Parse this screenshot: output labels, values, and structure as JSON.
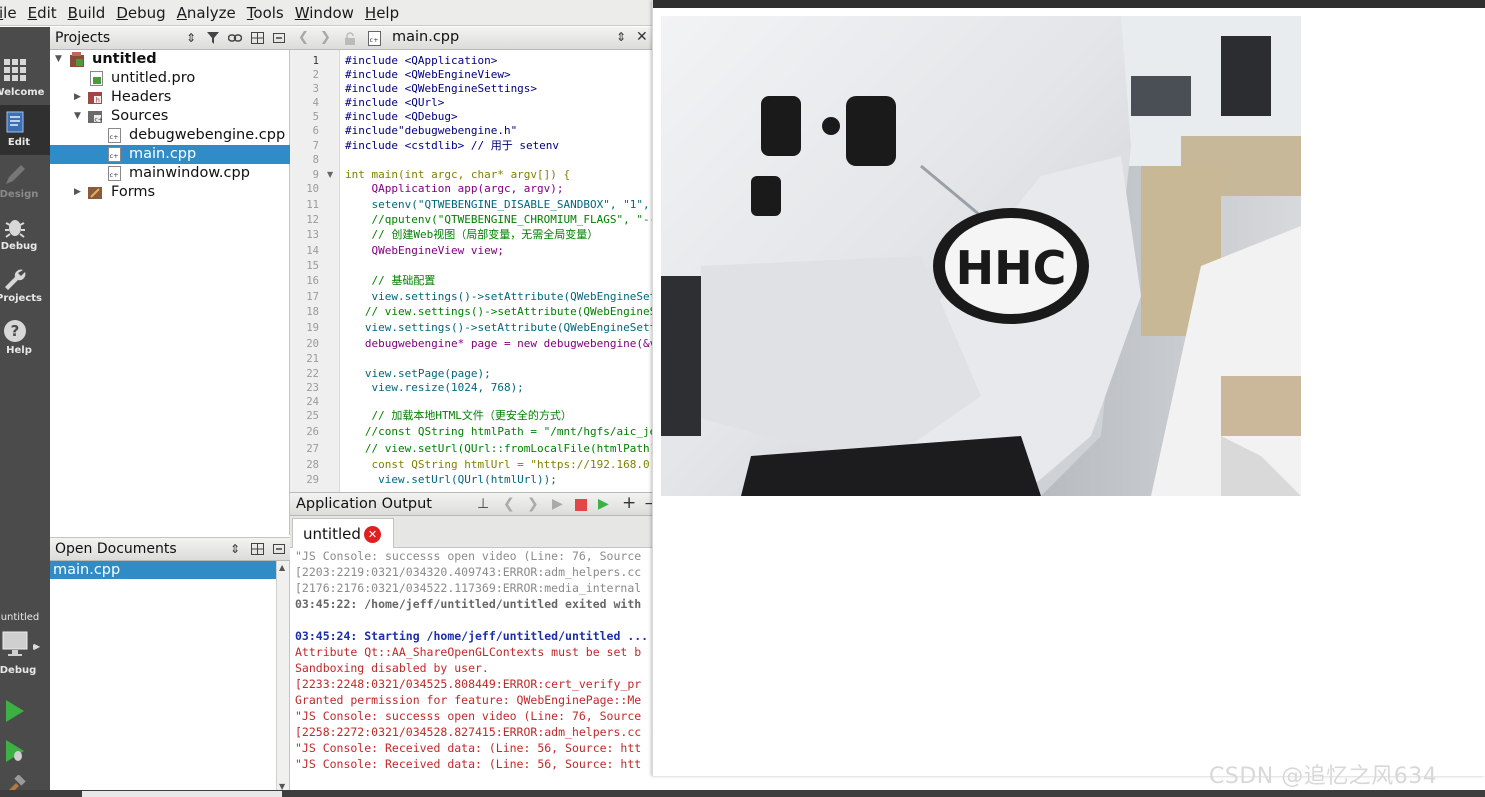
{
  "menubar": {
    "items": [
      "ile",
      "Edit",
      "Build",
      "Debug",
      "Analyze",
      "Tools",
      "Window",
      "Help"
    ]
  },
  "modebar": {
    "modes": [
      {
        "label": "Welcome",
        "icon": "grid-icon"
      },
      {
        "label": "Edit",
        "icon": "edit-document-icon"
      },
      {
        "label": "Design",
        "icon": "pen-icon"
      },
      {
        "label": "Debug",
        "icon": "bug-icon"
      },
      {
        "label": "Projects",
        "icon": "wrench-icon"
      },
      {
        "label": "Help",
        "icon": "help-icon"
      }
    ],
    "kit_label": "untitled",
    "kit_mode_label": "Debug"
  },
  "projects": {
    "header": "Projects",
    "tree": [
      {
        "label": "untitled",
        "level": 0,
        "type": "project",
        "bold": true
      },
      {
        "label": "untitled.pro",
        "level": 1,
        "type": "pro-file"
      },
      {
        "label": "Headers",
        "level": 1,
        "type": "folder-headers"
      },
      {
        "label": "Sources",
        "level": 1,
        "type": "folder-sources"
      },
      {
        "label": "debugwebengine.cpp",
        "level": 2,
        "type": "cpp-file"
      },
      {
        "label": "main.cpp",
        "level": 2,
        "type": "cpp-file",
        "selected": true
      },
      {
        "label": "mainwindow.cpp",
        "level": 2,
        "type": "cpp-file"
      },
      {
        "label": "Forms",
        "level": 1,
        "type": "folder-forms"
      }
    ]
  },
  "open_documents": {
    "header": "Open Documents",
    "items": [
      "main.cpp"
    ]
  },
  "editor": {
    "file_title": "main.cpp",
    "line_numbers": [
      "1",
      "2",
      "3",
      "4",
      "5",
      "6",
      "7",
      "8",
      "9",
      "10",
      "11",
      "12",
      "13",
      "14",
      "15",
      "16",
      "17",
      "18",
      "19",
      "20",
      "21",
      "22",
      "23",
      "24",
      "25",
      "26",
      "27",
      "28",
      "29"
    ],
    "lines": [
      "#include <QApplication>",
      "#include <QWebEngineView>",
      "#include <QWebEngineSettings>",
      "#include <QUrl>",
      "#include <QDebug>",
      "#include\"debugwebengine.h\"",
      "#include <cstdlib> // 用于 setenv",
      "",
      "int main(int argc, char* argv[]) {",
      "    QApplication app(argc, argv);",
      "    setenv(\"QTWEBENGINE_DISABLE_SANDBOX\", \"1\",",
      "    //qputenv(\"QTWEBENGINE_CHROMIUM_FLAGS\", \"--",
      "    // 创建Web视图（局部变量，无需全局变量）",
      "    QWebEngineView view;",
      "",
      "    // 基础配置",
      "    view.settings()->setAttribute(QWebEngineSet",
      "   // view.settings()->setAttribute(QWebEngineS",
      "   view.settings()->setAttribute(QWebEngineSett",
      "   debugwebengine* page = new debugwebengine(&v",
      "",
      "   view.setPage(page);",
      "    view.resize(1024, 768);",
      "",
      "    // 加载本地HTML文件（更安全的方式）",
      "   //const QString htmlPath = \"/mnt/hgfs/aic_je",
      "   // view.setUrl(QUrl::fromLocalFile(htmlPath)",
      "    const QString htmlUrl = \"https://192.168.0.",
      "     view.setUrl(QUrl(htmlUrl));"
    ]
  },
  "output": {
    "header": "Application Output",
    "tab_label": "untitled",
    "lines": [
      {
        "text": "\"JS Console: successs open video (Line: 76, Source",
        "style": "gray"
      },
      {
        "text": "[2203:2219:0321/034320.409743:ERROR:adm_helpers.cc",
        "style": "gray"
      },
      {
        "text": "[2176:2176:0321/034522.117369:ERROR:media_internal",
        "style": "gray"
      },
      {
        "text": "03:45:22: /home/jeff/untitled/untitled exited with",
        "style": "graybold"
      },
      {
        "text": "",
        "style": "gray"
      },
      {
        "text": "03:45:24: Starting /home/jeff/untitled/untitled ...",
        "style": "blue"
      },
      {
        "text": "Attribute Qt::AA_ShareOpenGLContexts must be set b",
        "style": "red"
      },
      {
        "text": "Sandboxing disabled by user.",
        "style": "red"
      },
      {
        "text": "[2233:2248:0321/034525.808449:ERROR:cert_verify_pr",
        "style": "red"
      },
      {
        "text": "Granted permission for feature: QWebEnginePage::Me",
        "style": "red"
      },
      {
        "text": "\"JS Console: successs open video (Line: 76, Source",
        "style": "red"
      },
      {
        "text": "[2258:2272:0321/034528.827415:ERROR:adm_helpers.cc",
        "style": "red"
      },
      {
        "text": "\"JS Console: Received data: (Line: 56, Source: htt",
        "style": "red"
      },
      {
        "text": "\"JS Console: Received data: (Line: 56, Source: htt",
        "style": "red"
      }
    ]
  },
  "webview": {
    "video_content": "camera-frame-white-jacket"
  },
  "watermark": "CSDN @追忆之风634",
  "colors": {
    "selection": "#308cc6",
    "modebar_bg": "#4b4b4b",
    "error_red": "#c32828",
    "starting_blue": "#1b2fa8",
    "tab_close": "#e02020"
  }
}
